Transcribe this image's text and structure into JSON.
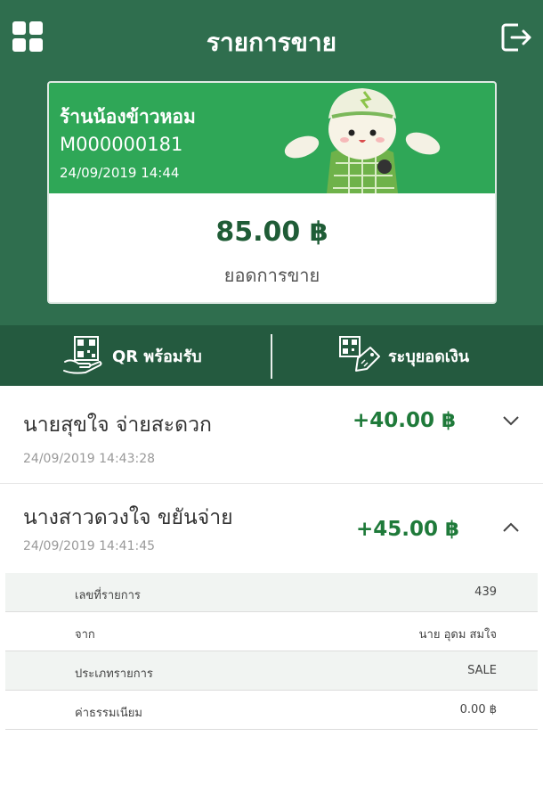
{
  "header": {
    "title": "รายการขาย",
    "menu_icon": "grid-menu-icon",
    "logout_icon": "logout-icon"
  },
  "summary_card": {
    "shop_name": "ร้านน้องข้าวหอม",
    "merchant_id": "M000000181",
    "datetime": "24/09/2019 14:44",
    "total_amount": "85.00 ฿",
    "total_label": "ยอดการขาย"
  },
  "actions": {
    "qr_label": "QR พร้อมรับ",
    "amount_label": "ระบุยอดเงิน"
  },
  "transactions": [
    {
      "name": "นายสุขใจ  จ่ายสะดวก",
      "amount": "+40.00 ฿",
      "datetime": "24/09/2019 14:43:28",
      "expanded": false
    },
    {
      "name": "นางสาวดวงใจ  ขยันจ่าย",
      "amount": "+45.00 ฿",
      "datetime": "24/09/2019 14:41:45",
      "expanded": true
    }
  ],
  "details": [
    {
      "label": "เลขที่รายการ",
      "value": "439"
    },
    {
      "label": "จาก",
      "value": "นาย อุดม สมใจ"
    },
    {
      "label": "ประเภทรายการ",
      "value": "SALE"
    },
    {
      "label": "ค่าธรรมเนียม",
      "value": "0.00 ฿"
    }
  ],
  "colors": {
    "header_bg": "#2f6e4e",
    "action_bar_bg": "#245a3f",
    "card_green": "#2fa757",
    "amount_green": "#1f7a3a"
  }
}
